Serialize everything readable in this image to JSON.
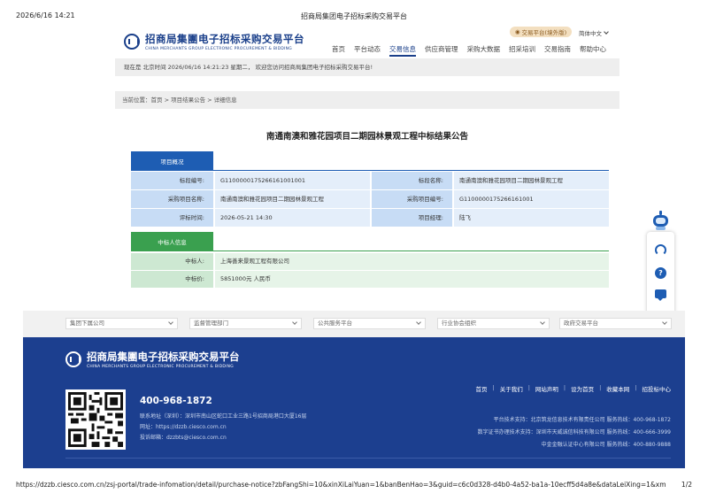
{
  "print": {
    "datetime": "2026/6/16 14:21",
    "doc_title": "招商局集团电子招标采购交易平台",
    "url": "https://dzzb.ciesco.com.cn/zsj-portal/trade-infomation/detail/purchase-notice?zbFangShi=10&xinXiLaiYuan=1&banBenHao=3&guid=c6c0d328-d4b0-4a52-ba1a-10ecff5d4a8e&dataLeiXing=1&xmBH=&bdBH=G11000...",
    "page": "1/2"
  },
  "header": {
    "logo_cn": "招商局集團电子招标采购交易平台",
    "logo_en": "CHINA MERCHANTS GROUP ELECTRONIC PROCUREMENT & BIDDING",
    "foreign_btn": "交易平台(境外版)",
    "lang": "简体中文",
    "nav": [
      "首页",
      "平台动态",
      "交易信息",
      "供应商管理",
      "采购大数据",
      "招采培训",
      "交易指南",
      "帮助中心"
    ],
    "active_nav": "交易信息"
  },
  "welcome": "现在是 北京时间 2026/06/16 14:21:23 星期二， 欢迎您访问招商局集团电子招标采购交易平台!",
  "breadcrumb": "当前位置：首页 > 项目结果公告 > 详细信息",
  "title": "南通南澳和雅花园项目二期园林景观工程中标结果公告",
  "project": {
    "section": "项目概况",
    "rows": [
      {
        "l1": "标段编号:",
        "v1": "G1100000175266161001001",
        "l2": "标段名称:",
        "v2": "南通南澳和雅花园项目二期园林景观工程"
      },
      {
        "l1": "采购项目名称:",
        "v1": "南通南澳和雅花园项目二期园林景观工程",
        "l2": "采购项目编号:",
        "v2": "G1100000175266161001"
      },
      {
        "l1": "评标时间:",
        "v1": "2026-05-21 14:30",
        "l2": "项目经理:",
        "v2": "陆飞"
      }
    ]
  },
  "winner": {
    "section": "中标人信息",
    "rows": [
      {
        "label": "中标人:",
        "value": "上海善来景观工程有限公司"
      },
      {
        "label": "中标价:",
        "value": "5851000元 人民币"
      }
    ]
  },
  "dropdowns": [
    "集团下属公司",
    "监督管理部门",
    "公共服务平台",
    "行业协会组织",
    "政府交易平台"
  ],
  "footer": {
    "logo_cn": "招商局集團电子招标采购交易平台",
    "logo_en": "CHINA MERCHANTS GROUP ELECTRONIC PROCUREMENT & BIDDING",
    "links": [
      "首页",
      "关于我们",
      "网站声明",
      "设为首页",
      "收藏本网",
      "招投标中心"
    ],
    "hotline": "400-968-1872",
    "address": "联系地址（深圳）：深圳市南山区蛇口工业三路1号招商局港口大厦16层",
    "website": "网址：https://dzzb.ciesco.com.cn",
    "email": "投诉邮箱：dzzbts@ciesco.com.cn",
    "support": [
      "平台技术支持：北京筑龙信息技术有限责任公司 服务热线：400-968-1872",
      "数字证书办理技术支持：深圳市天威诚信科技有限公司 服务热线：400-666-3999",
      "中金金融认证中心有限公司 服务热线：400-880-9888"
    ]
  },
  "colors": {
    "brand": "#1a3f8a",
    "tab_blue": "#1e5db3",
    "tab_green": "#3aa04f",
    "footer": "#1c3f8f"
  }
}
